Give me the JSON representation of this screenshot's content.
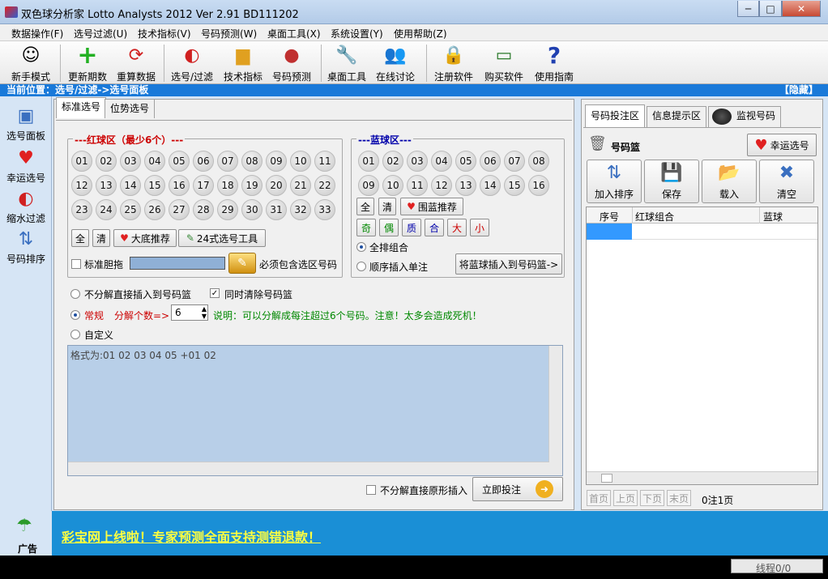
{
  "window": {
    "title": "双色球分析家 Lotto Analysts 2012 Ver 2.91 BD111202",
    "min": "─",
    "max": "□",
    "close": "✕"
  },
  "menu": [
    "数据操作(F)",
    "选号过滤(U)",
    "技术指标(V)",
    "号码预测(W)",
    "桌面工具(X)",
    "系统设置(Y)",
    "使用帮助(Z)"
  ],
  "toolbar": [
    "新手模式",
    "更新期数",
    "重算数据",
    "选号/过滤",
    "技术指标",
    "号码预测",
    "桌面工具",
    "在线讨论",
    "注册软件",
    "购买软件",
    "使用指南"
  ],
  "location": {
    "label": "当前位置：选号/过滤->选号面板",
    "hide": "【隐藏】"
  },
  "leftnav": [
    "选号面板",
    "幸运选号",
    "缩水过滤",
    "号码排序"
  ],
  "tabs": [
    "标准选号",
    "位势选号"
  ],
  "red": {
    "title": "---红球区（最少6个）---",
    "balls": [
      "01",
      "02",
      "03",
      "04",
      "05",
      "06",
      "07",
      "08",
      "09",
      "10",
      "11",
      "12",
      "13",
      "14",
      "15",
      "16",
      "17",
      "18",
      "19",
      "20",
      "21",
      "22",
      "23",
      "24",
      "25",
      "26",
      "27",
      "28",
      "29",
      "30",
      "31",
      "32",
      "33"
    ],
    "all": "全",
    "clear": "清",
    "recommend": "大底推荐",
    "tool": "24式选号工具",
    "bold_label": "标准胆拖",
    "must_label": "必须包含选区号码"
  },
  "blue": {
    "title": "---蓝球区---",
    "balls": [
      "01",
      "02",
      "03",
      "04",
      "05",
      "06",
      "07",
      "08",
      "09",
      "10",
      "11",
      "12",
      "13",
      "14",
      "15",
      "16"
    ],
    "all": "全",
    "clear": "清",
    "recommend": "围蓝推荐",
    "filters": [
      "奇",
      "偶",
      "质",
      "合",
      "大",
      "小"
    ],
    "opt1": "全排组合",
    "opt2": "顺序插入单注",
    "insert": "将蓝球插入到号码篮->"
  },
  "options": {
    "direct": "不分解直接插入到号码篮",
    "clear_basket": "同时清除号码篮",
    "normal": "常规",
    "split_label": "分解个数=>",
    "split_value": "6",
    "note": "说明：可以分解成每注超过6个号码。注意！太多会造成死机！",
    "custom": "自定义",
    "format": "格式为:01 02 03 04 05 +01 02",
    "raw_insert": "不分解直接原形插入",
    "submit": "立即投注"
  },
  "right": {
    "tabs": [
      "号码投注区",
      "信息提示区",
      "监视号码"
    ],
    "basket": "号码篮",
    "lucky": "幸运选号",
    "buttons": [
      "加入排序",
      "保存",
      "载入",
      "清空"
    ],
    "columns": [
      "序号",
      "红球组合",
      "蓝球"
    ],
    "pager": [
      "首页",
      "上页",
      "下页",
      "末页"
    ],
    "count": "0注1页"
  },
  "ad": {
    "label": "广告",
    "text": "彩宝网上线啦！专家预测全面支持测错退款！"
  },
  "status": {
    "text": "线程0/0"
  },
  "colors": {
    "accent": "#1979d9",
    "red": "#cc0000",
    "blue": "#0000aa",
    "note": "#008800"
  }
}
